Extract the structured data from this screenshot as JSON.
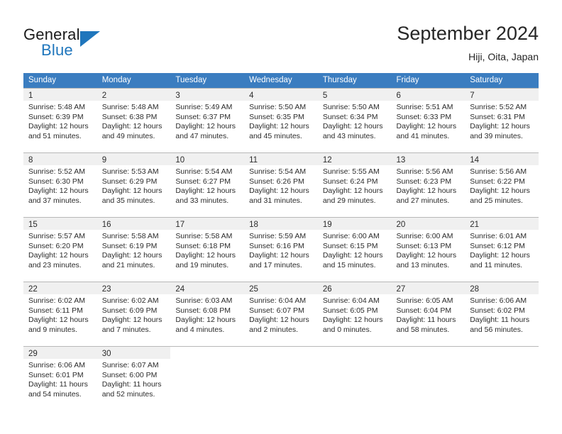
{
  "brand": {
    "name_part1": "General",
    "name_part2": "Blue",
    "accent_color": "#1f76bc"
  },
  "header": {
    "title": "September 2024",
    "subtitle": "Hiji, Oita, Japan"
  },
  "calendar": {
    "header_bg": "#3b7dc0",
    "daynum_bg": "#f0f0f0",
    "weekdays": [
      "Sunday",
      "Monday",
      "Tuesday",
      "Wednesday",
      "Thursday",
      "Friday",
      "Saturday"
    ],
    "weeks": [
      [
        {
          "day": "1",
          "sunrise": "Sunrise: 5:48 AM",
          "sunset": "Sunset: 6:39 PM",
          "daylight1": "Daylight: 12 hours",
          "daylight2": "and 51 minutes."
        },
        {
          "day": "2",
          "sunrise": "Sunrise: 5:48 AM",
          "sunset": "Sunset: 6:38 PM",
          "daylight1": "Daylight: 12 hours",
          "daylight2": "and 49 minutes."
        },
        {
          "day": "3",
          "sunrise": "Sunrise: 5:49 AM",
          "sunset": "Sunset: 6:37 PM",
          "daylight1": "Daylight: 12 hours",
          "daylight2": "and 47 minutes."
        },
        {
          "day": "4",
          "sunrise": "Sunrise: 5:50 AM",
          "sunset": "Sunset: 6:35 PM",
          "daylight1": "Daylight: 12 hours",
          "daylight2": "and 45 minutes."
        },
        {
          "day": "5",
          "sunrise": "Sunrise: 5:50 AM",
          "sunset": "Sunset: 6:34 PM",
          "daylight1": "Daylight: 12 hours",
          "daylight2": "and 43 minutes."
        },
        {
          "day": "6",
          "sunrise": "Sunrise: 5:51 AM",
          "sunset": "Sunset: 6:33 PM",
          "daylight1": "Daylight: 12 hours",
          "daylight2": "and 41 minutes."
        },
        {
          "day": "7",
          "sunrise": "Sunrise: 5:52 AM",
          "sunset": "Sunset: 6:31 PM",
          "daylight1": "Daylight: 12 hours",
          "daylight2": "and 39 minutes."
        }
      ],
      [
        {
          "day": "8",
          "sunrise": "Sunrise: 5:52 AM",
          "sunset": "Sunset: 6:30 PM",
          "daylight1": "Daylight: 12 hours",
          "daylight2": "and 37 minutes."
        },
        {
          "day": "9",
          "sunrise": "Sunrise: 5:53 AM",
          "sunset": "Sunset: 6:29 PM",
          "daylight1": "Daylight: 12 hours",
          "daylight2": "and 35 minutes."
        },
        {
          "day": "10",
          "sunrise": "Sunrise: 5:54 AM",
          "sunset": "Sunset: 6:27 PM",
          "daylight1": "Daylight: 12 hours",
          "daylight2": "and 33 minutes."
        },
        {
          "day": "11",
          "sunrise": "Sunrise: 5:54 AM",
          "sunset": "Sunset: 6:26 PM",
          "daylight1": "Daylight: 12 hours",
          "daylight2": "and 31 minutes."
        },
        {
          "day": "12",
          "sunrise": "Sunrise: 5:55 AM",
          "sunset": "Sunset: 6:24 PM",
          "daylight1": "Daylight: 12 hours",
          "daylight2": "and 29 minutes."
        },
        {
          "day": "13",
          "sunrise": "Sunrise: 5:56 AM",
          "sunset": "Sunset: 6:23 PM",
          "daylight1": "Daylight: 12 hours",
          "daylight2": "and 27 minutes."
        },
        {
          "day": "14",
          "sunrise": "Sunrise: 5:56 AM",
          "sunset": "Sunset: 6:22 PM",
          "daylight1": "Daylight: 12 hours",
          "daylight2": "and 25 minutes."
        }
      ],
      [
        {
          "day": "15",
          "sunrise": "Sunrise: 5:57 AM",
          "sunset": "Sunset: 6:20 PM",
          "daylight1": "Daylight: 12 hours",
          "daylight2": "and 23 minutes."
        },
        {
          "day": "16",
          "sunrise": "Sunrise: 5:58 AM",
          "sunset": "Sunset: 6:19 PM",
          "daylight1": "Daylight: 12 hours",
          "daylight2": "and 21 minutes."
        },
        {
          "day": "17",
          "sunrise": "Sunrise: 5:58 AM",
          "sunset": "Sunset: 6:18 PM",
          "daylight1": "Daylight: 12 hours",
          "daylight2": "and 19 minutes."
        },
        {
          "day": "18",
          "sunrise": "Sunrise: 5:59 AM",
          "sunset": "Sunset: 6:16 PM",
          "daylight1": "Daylight: 12 hours",
          "daylight2": "and 17 minutes."
        },
        {
          "day": "19",
          "sunrise": "Sunrise: 6:00 AM",
          "sunset": "Sunset: 6:15 PM",
          "daylight1": "Daylight: 12 hours",
          "daylight2": "and 15 minutes."
        },
        {
          "day": "20",
          "sunrise": "Sunrise: 6:00 AM",
          "sunset": "Sunset: 6:13 PM",
          "daylight1": "Daylight: 12 hours",
          "daylight2": "and 13 minutes."
        },
        {
          "day": "21",
          "sunrise": "Sunrise: 6:01 AM",
          "sunset": "Sunset: 6:12 PM",
          "daylight1": "Daylight: 12 hours",
          "daylight2": "and 11 minutes."
        }
      ],
      [
        {
          "day": "22",
          "sunrise": "Sunrise: 6:02 AM",
          "sunset": "Sunset: 6:11 PM",
          "daylight1": "Daylight: 12 hours",
          "daylight2": "and 9 minutes."
        },
        {
          "day": "23",
          "sunrise": "Sunrise: 6:02 AM",
          "sunset": "Sunset: 6:09 PM",
          "daylight1": "Daylight: 12 hours",
          "daylight2": "and 7 minutes."
        },
        {
          "day": "24",
          "sunrise": "Sunrise: 6:03 AM",
          "sunset": "Sunset: 6:08 PM",
          "daylight1": "Daylight: 12 hours",
          "daylight2": "and 4 minutes."
        },
        {
          "day": "25",
          "sunrise": "Sunrise: 6:04 AM",
          "sunset": "Sunset: 6:07 PM",
          "daylight1": "Daylight: 12 hours",
          "daylight2": "and 2 minutes."
        },
        {
          "day": "26",
          "sunrise": "Sunrise: 6:04 AM",
          "sunset": "Sunset: 6:05 PM",
          "daylight1": "Daylight: 12 hours",
          "daylight2": "and 0 minutes."
        },
        {
          "day": "27",
          "sunrise": "Sunrise: 6:05 AM",
          "sunset": "Sunset: 6:04 PM",
          "daylight1": "Daylight: 11 hours",
          "daylight2": "and 58 minutes."
        },
        {
          "day": "28",
          "sunrise": "Sunrise: 6:06 AM",
          "sunset": "Sunset: 6:02 PM",
          "daylight1": "Daylight: 11 hours",
          "daylight2": "and 56 minutes."
        }
      ],
      [
        {
          "day": "29",
          "sunrise": "Sunrise: 6:06 AM",
          "sunset": "Sunset: 6:01 PM",
          "daylight1": "Daylight: 11 hours",
          "daylight2": "and 54 minutes."
        },
        {
          "day": "30",
          "sunrise": "Sunrise: 6:07 AM",
          "sunset": "Sunset: 6:00 PM",
          "daylight1": "Daylight: 11 hours",
          "daylight2": "and 52 minutes."
        },
        {
          "day": "",
          "sunrise": "",
          "sunset": "",
          "daylight1": "",
          "daylight2": ""
        },
        {
          "day": "",
          "sunrise": "",
          "sunset": "",
          "daylight1": "",
          "daylight2": ""
        },
        {
          "day": "",
          "sunrise": "",
          "sunset": "",
          "daylight1": "",
          "daylight2": ""
        },
        {
          "day": "",
          "sunrise": "",
          "sunset": "",
          "daylight1": "",
          "daylight2": ""
        },
        {
          "day": "",
          "sunrise": "",
          "sunset": "",
          "daylight1": "",
          "daylight2": ""
        }
      ]
    ]
  }
}
